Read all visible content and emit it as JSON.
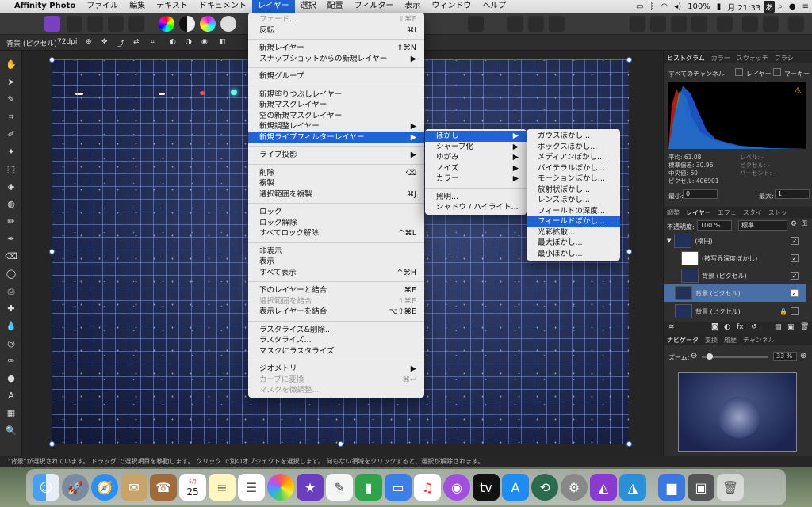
{
  "menubar": {
    "app_name": "Affinity Photo",
    "items": [
      "ファイル",
      "編集",
      "テキスト",
      "ドキュメント",
      "レイヤー",
      "選択",
      "配置",
      "フィルター",
      "表示",
      "ウィンドウ",
      "ヘルプ"
    ],
    "battery": "100%",
    "clock": "月 21:33"
  },
  "context": {
    "layer_label": "背景 (ピクセル)",
    "dpi": "72dpi"
  },
  "layer_menu": {
    "items": [
      {
        "label": "フェード...",
        "shortcut": "⇧⌘F",
        "disabled": true
      },
      {
        "label": "反転",
        "shortcut": "⌘I"
      },
      {
        "sep": true
      },
      {
        "label": "新規レイヤー",
        "shortcut": "⇧⌘N"
      },
      {
        "label": "スナップショットからの新規レイヤー",
        "shortcut": "▶"
      },
      {
        "sep": true
      },
      {
        "label": "新規グループ",
        "shortcut": ""
      },
      {
        "sep": true
      },
      {
        "label": "新規塗りつぶしレイヤー",
        "shortcut": ""
      },
      {
        "label": "新規マスクレイヤー",
        "shortcut": ""
      },
      {
        "label": "空の新規マスクレイヤー",
        "shortcut": ""
      },
      {
        "label": "新規調整レイヤー",
        "shortcut": "▶"
      },
      {
        "label": "新規ライブフィルターレイヤー",
        "shortcut": "▶",
        "highlight": true
      },
      {
        "sep": true
      },
      {
        "label": "ライブ投影",
        "shortcut": "▶"
      },
      {
        "sep": true
      },
      {
        "label": "削除",
        "shortcut": "⌫"
      },
      {
        "label": "複製",
        "shortcut": ""
      },
      {
        "label": "選択範囲を複製",
        "shortcut": "⌘J"
      },
      {
        "sep": true
      },
      {
        "label": "ロック",
        "shortcut": ""
      },
      {
        "label": "ロック解除",
        "shortcut": ""
      },
      {
        "label": "すべてロック解除",
        "shortcut": "^⌘L"
      },
      {
        "sep": true
      },
      {
        "label": "非表示",
        "shortcut": ""
      },
      {
        "label": "表示",
        "shortcut": ""
      },
      {
        "label": "すべて表示",
        "shortcut": "^⌘H"
      },
      {
        "sep": true
      },
      {
        "label": "下のレイヤーと結合",
        "shortcut": "⌘E"
      },
      {
        "label": "選択範囲を結合",
        "shortcut": "⇧⌘E",
        "disabled": true
      },
      {
        "label": "表示レイヤーを結合",
        "shortcut": "⌥⇧⌘E"
      },
      {
        "sep": true
      },
      {
        "label": "ラスタライズ&削除...",
        "shortcut": ""
      },
      {
        "label": "ラスタライズ...",
        "shortcut": ""
      },
      {
        "label": "マスクにラスタライズ",
        "shortcut": ""
      },
      {
        "sep": true
      },
      {
        "label": "ジオメトリ",
        "shortcut": "▶"
      },
      {
        "label": "カーブに変換",
        "shortcut": "⌘↩",
        "disabled": true
      },
      {
        "label": "マスクを微調整...",
        "shortcut": "",
        "disabled": true
      }
    ]
  },
  "live_filter_menu": {
    "items": [
      {
        "label": "ぼかし",
        "shortcut": "▶",
        "highlight": true
      },
      {
        "label": "シャープ化",
        "shortcut": "▶"
      },
      {
        "label": "ゆがみ",
        "shortcut": "▶"
      },
      {
        "label": "ノイズ",
        "shortcut": "▶"
      },
      {
        "label": "カラー",
        "shortcut": "▶"
      },
      {
        "sep": true
      },
      {
        "label": "照明...",
        "shortcut": ""
      },
      {
        "label": "シャドウ / ハイライト...",
        "shortcut": ""
      }
    ]
  },
  "blur_menu": {
    "items": [
      {
        "label": "ガウスぼかし..."
      },
      {
        "label": "ボックスぼかし..."
      },
      {
        "label": "メディアンぼかし..."
      },
      {
        "label": "バイテラルぼかし..."
      },
      {
        "label": "モーションぼかし..."
      },
      {
        "label": "放射状ぼかし..."
      },
      {
        "label": "レンズぼかし..."
      },
      {
        "label": "フィールドの深度..."
      },
      {
        "label": "フィールドぼかし...",
        "highlight": true
      },
      {
        "label": "光彩拡散..."
      },
      {
        "label": "最大ぼかし..."
      },
      {
        "label": "最小ぼかし..."
      }
    ]
  },
  "histogram": {
    "tabs": [
      "ヒストグラム",
      "カラー",
      "スウォッチ",
      "ブラシ"
    ],
    "channel": "すべてのチャンネル",
    "layer_label": "レイヤー",
    "marquee_label": "マーキー",
    "stats_left": [
      "平均: 61.08",
      "標準偏差: 30.96",
      "中央値: 60",
      "ピクセル: 406901"
    ],
    "stats_right": [
      "レベル: -",
      "ピクセル: -",
      "パーセント: -"
    ],
    "min_label": "最小:",
    "min_value": "0",
    "max_label": "最大:",
    "max_value": "1"
  },
  "layers": {
    "tabs": [
      "調整",
      "レイヤー",
      "エフェ",
      "スタイ",
      "ストッ"
    ],
    "opacity_label": "不透明度:",
    "opacity_value": "100 %",
    "blend_mode": "標準",
    "rows": [
      {
        "label": "(楕円)"
      },
      {
        "label": "(被写界深度ぼかし)"
      },
      {
        "label": "背景 (ピクセル)"
      },
      {
        "label": "背景 (ピクセル)",
        "selected": true
      },
      {
        "label": "背景 (ピクセル)"
      }
    ]
  },
  "navigator": {
    "tabs": [
      "ナビゲータ",
      "変換",
      "履歴",
      "チャンネル"
    ],
    "zoom_label": "ズーム:",
    "zoom_value": "33 %"
  },
  "statusbar": {
    "text": "\"背景\"が選択されています。 ドラッグ で選択項目を移動します。 クリック で別のオブジェクトを選択します。 何もない領域をクリックすると、選択が解除されます。"
  },
  "dock": {
    "calendar_month": "5月",
    "calendar_day": "25",
    "apps": [
      "finder",
      "launchpad",
      "safari",
      "mail-stamp",
      "contacts",
      "calendar",
      "notes",
      "reminders",
      "photos",
      "imovie",
      "textedit",
      "numbers",
      "keynote",
      "music",
      "podcasts",
      "appletv",
      "appstore",
      "timemachine",
      "system-preferences",
      "affinity-photo",
      "affinity-designer",
      "folder",
      "screenshot",
      "trash"
    ]
  },
  "colors": {
    "accent": "#1f63d5",
    "canvas_grid": "#7896e6"
  }
}
